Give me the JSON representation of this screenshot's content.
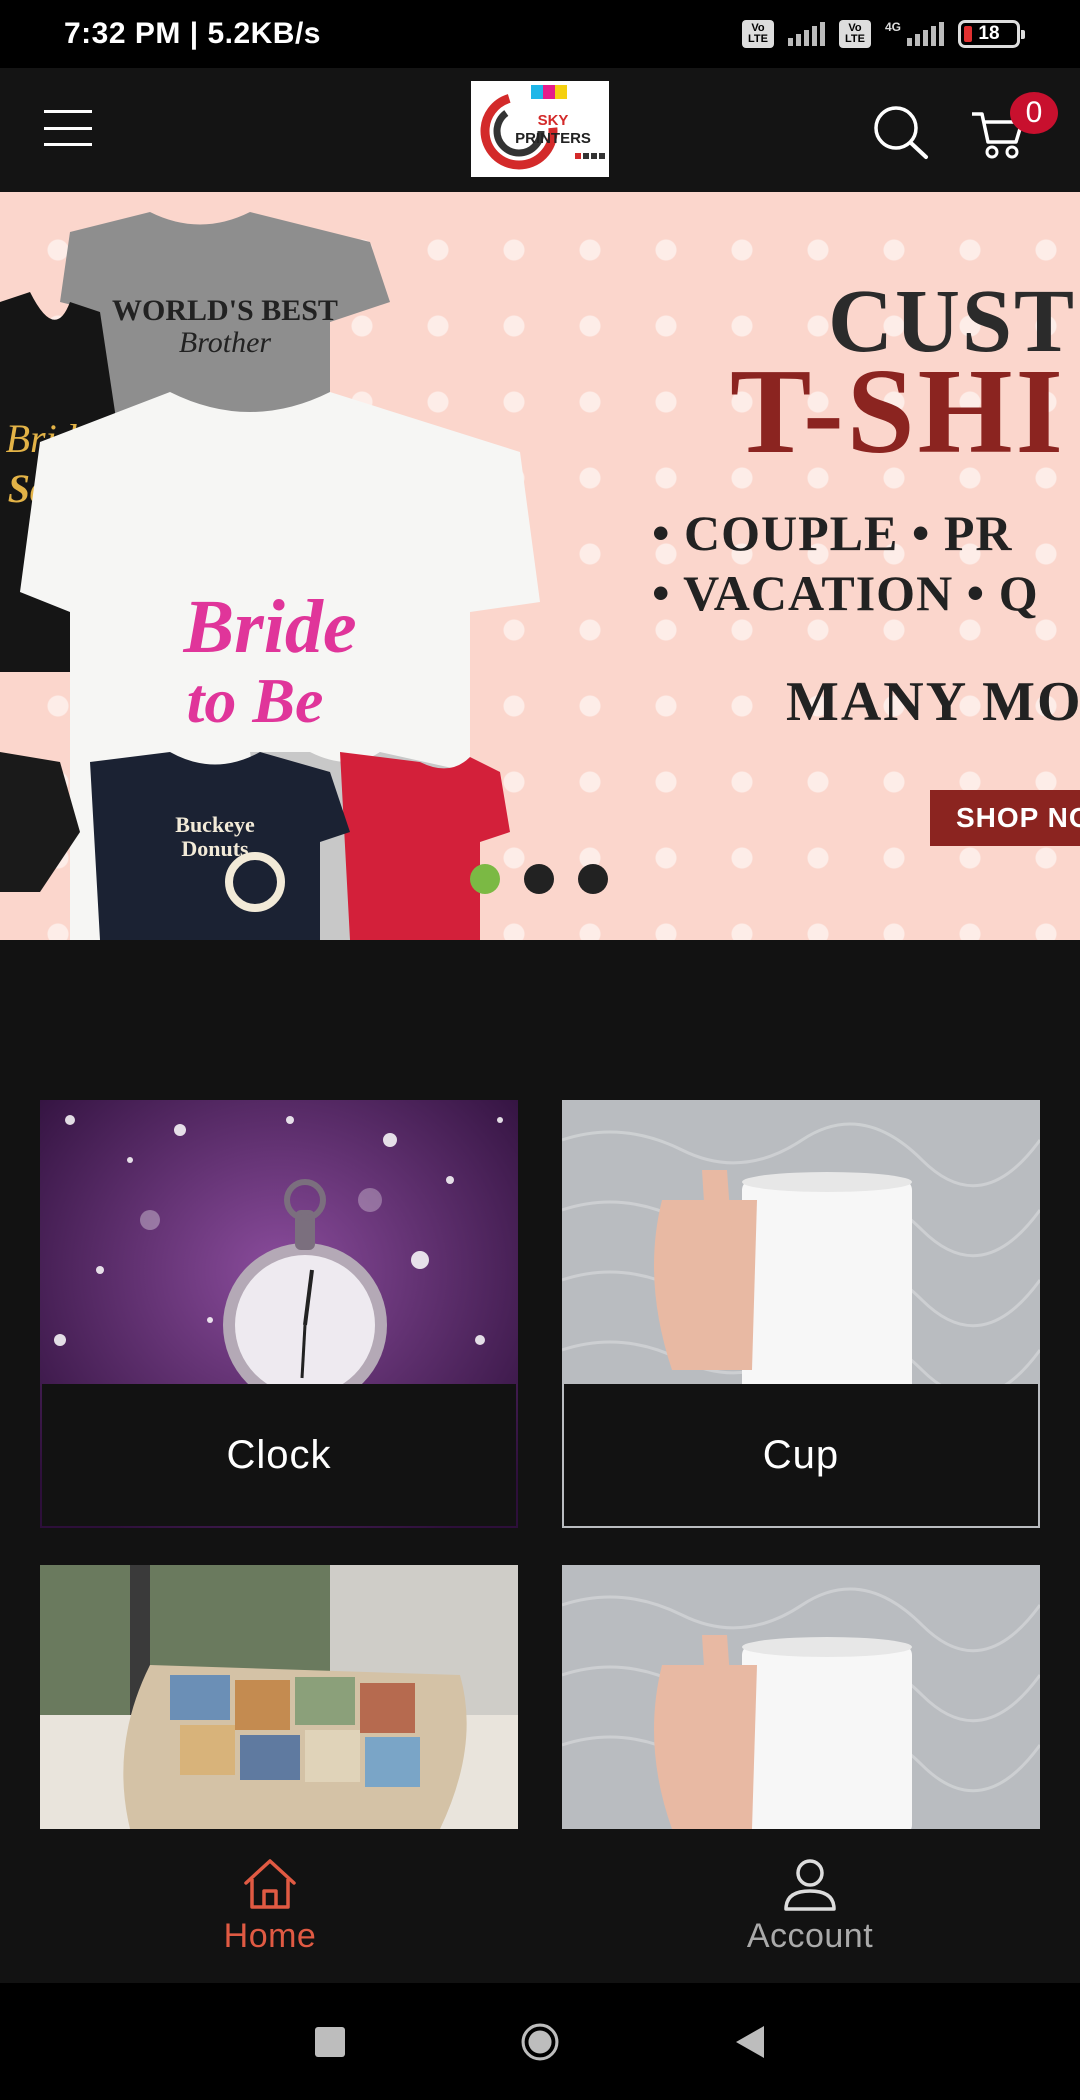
{
  "status_bar": {
    "time_speed": "7:32 PM | 5.2KB/s",
    "volte_1": "Vo LTE",
    "volte_2": "Vo LTE",
    "network": "4G",
    "battery": "18"
  },
  "header": {
    "logo_text_1": "SKY",
    "logo_text_2": "PRINTERS",
    "cart_count": "0"
  },
  "hero": {
    "title_line_1": "CUST",
    "title_line_2": "T-SHI",
    "bullet_line_1": "• COUPLE   • PR",
    "bullet_line_2": "• VACATION • Q",
    "more_text": "MANY MO",
    "shop_button": "SHOP NO",
    "shirt_text_1": "WORLD'S BEST",
    "shirt_text_2": "Brother",
    "shirt_text_3": "Bride",
    "shirt_text_4": "Squad",
    "shirt_text_5": "Bride",
    "shirt_text_6": "to Be",
    "shirt_text_7": "Buckeye",
    "shirt_text_8": "Donuts",
    "slides_total": 3,
    "active_slide": 1
  },
  "categories": [
    {
      "label": "Clock"
    },
    {
      "label": "Cup"
    },
    {
      "label": ""
    },
    {
      "label": ""
    }
  ],
  "bottom_nav": {
    "home": "Home",
    "account": "Account"
  },
  "colors": {
    "accent": "#e05a43",
    "brand_red": "#8b2420",
    "badge": "#c8102e",
    "dot_active": "#7bb944"
  }
}
